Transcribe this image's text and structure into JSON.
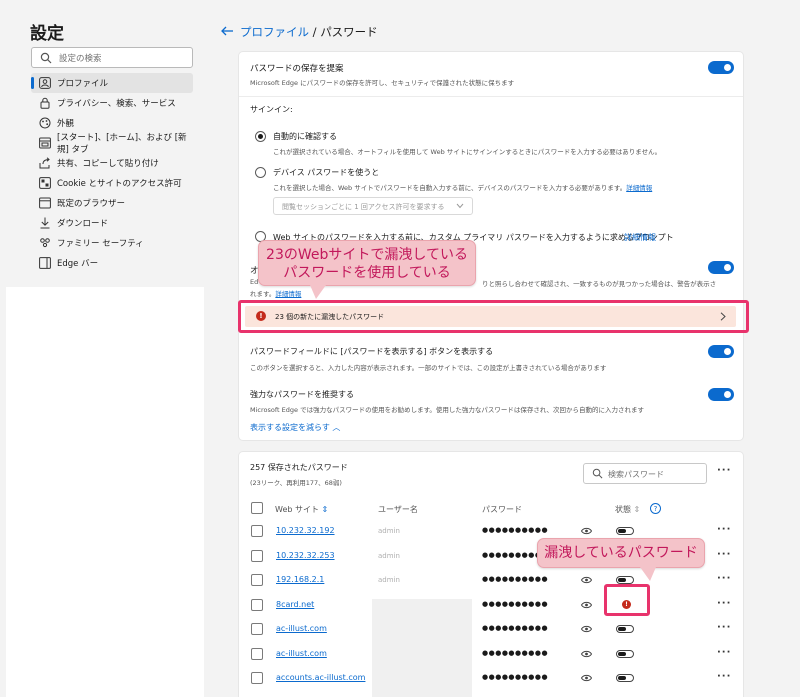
{
  "sidebar": {
    "title": "設定",
    "search_placeholder": "設定の検索",
    "items": [
      {
        "label": "プロファイル",
        "icon": "profile-icon",
        "active": true
      },
      {
        "label": "プライバシー、検索、サービス",
        "icon": "lock-icon"
      },
      {
        "label": "外観",
        "icon": "appearance-icon"
      },
      {
        "label": "[スタート]、[ホーム]、および [新規] タブ",
        "icon": "start-tab-icon"
      },
      {
        "label": "共有、コピーして貼り付け",
        "icon": "share-icon"
      },
      {
        "label": "Cookie とサイトのアクセス許可",
        "icon": "cookie-icon"
      },
      {
        "label": "既定のブラウザー",
        "icon": "browser-icon"
      },
      {
        "label": "ダウンロード",
        "icon": "download-icon"
      },
      {
        "label": "ファミリー セーフティ",
        "icon": "family-icon"
      },
      {
        "label": "Edge バー",
        "icon": "edge-bar-icon"
      }
    ]
  },
  "breadcrumb": {
    "parent": "プロファイル",
    "sep": " / ",
    "current": "パスワード"
  },
  "settings": {
    "offer_save": {
      "title": "パスワードの保存を提案",
      "desc": "Microsoft Edge にパスワードの保存を許可し、セキュリティで保護された状態に保ちます"
    },
    "signin_label": "サインイン:",
    "auto_confirm": {
      "title": "自動的に確認する",
      "desc": "これが選択されている場合、オートフィルを使用して Web サイトにサインインするときにパスワードを入力する必要はありません。"
    },
    "device_pw": {
      "title": "デバイス パスワードを使うと",
      "desc": "これを選択した場合、Web サイトでパスワードを自動入力する前に、デバイスのパスワードを入力する必要があります。",
      "link": "詳細情報"
    },
    "dropdown": "閲覧セッションごとに 1 回アクセス許可を要求する",
    "web_prompt": {
      "title": "Web サイトのパスワードを入力する前に、カスタム プライマリ パスワードを入力するように求めるプロンプト",
      "link": "詳細情報"
    },
    "leak_alert": {
      "title": "オ",
      "desc_start": "Ed",
      "desc_end": "りと照らし合わせて確認され、一致するものが見つかった場合は、警告が表示さ",
      "desc2": "れます。",
      "link": "詳細情報"
    },
    "leak_banner": {
      "icon": "!",
      "text": "23 個の新たに漏洩したパスワード"
    },
    "reveal_btn": {
      "title": "パスワードフィールドに [パスワードを表示する] ボタンを表示する",
      "desc": "このボタンを選択すると、入力した内容が表示されます。一部のサイトでは、この設定が上書きされている場合があります"
    },
    "strong_pw": {
      "title": "強力なパスワードを推奨する",
      "desc": "Microsoft Edge では強力なパスワードの使用をお勧めします。使用した強力なパスワードは保存され、次回から自動的に入力されます"
    },
    "show_less": "表示する設定を減らす"
  },
  "callouts": {
    "leak": [
      "23のWebサイトで漏洩している",
      "パスワードを使用している"
    ],
    "leaked_pw": "漏洩しているパスワード"
  },
  "saved": {
    "title": "257 保存されたパスワード",
    "subtitle": "(23リーク、再利用177、68弱)",
    "search_placeholder": "検索パスワード",
    "more": "···",
    "columns": {
      "site": "Web サイト",
      "user": "ユーザー名",
      "password": "パスワード",
      "status": "状態"
    },
    "rows": [
      {
        "site": "10.232.32.192",
        "user": "admin",
        "password": "●●●●●●●●●●",
        "status": "pill"
      },
      {
        "site": "10.232.32.253",
        "user": "admin",
        "password": "●●●●●●●●●●",
        "status": "pill"
      },
      {
        "site": "192.168.2.1",
        "user": "admin",
        "password": "●●●●●●●●●●",
        "status": "pill"
      },
      {
        "site": "8card.net",
        "user": "",
        "password": "●●●●●●●●●●",
        "status": "leak",
        "status_text": "!"
      },
      {
        "site": "ac-illust.com",
        "user": "",
        "password": "●●●●●●●●●●",
        "status": "pill"
      },
      {
        "site": "ac-illust.com",
        "user": "",
        "password": "●●●●●●●●●●",
        "status": "pill"
      },
      {
        "site": "accounts.ac-illust.com",
        "user": "",
        "password": "●●●●●●●●●●",
        "status": "pill"
      }
    ]
  },
  "colors": {
    "accent": "#0b6ace",
    "highlight": "#e8336c",
    "leak_bg": "#fbe5dc",
    "callout_bg": "#f4c3c9",
    "callout_text": "#c2185b"
  }
}
